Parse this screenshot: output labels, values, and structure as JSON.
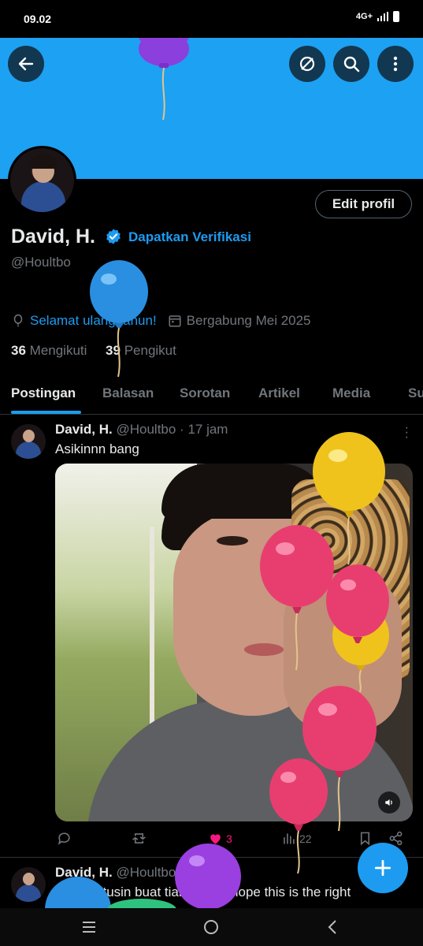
{
  "status_bar": {
    "time": "09.02",
    "network": "4G+"
  },
  "header": {
    "back_icon": "arrow-left-icon",
    "action_icons": [
      "no-grok-icon",
      "search-icon",
      "more-vertical-icon"
    ],
    "banner_color": "#1da1f2"
  },
  "profile": {
    "edit_label": "Edit profil",
    "name": "David, H.",
    "verify_label": "Dapatkan Verifikasi",
    "handle": "@Houltbo",
    "birthday_label": "Selamat ulang tahun!",
    "joined_label": "Bergabung Mei 2025",
    "following_count": "36",
    "following_label": "Mengikuti",
    "followers_count": "39",
    "followers_label": "Pengikut"
  },
  "tabs": [
    {
      "label": "Postingan",
      "active": true
    },
    {
      "label": "Balasan",
      "active": false
    },
    {
      "label": "Sorotan",
      "active": false
    },
    {
      "label": "Artikel",
      "active": false
    },
    {
      "label": "Media",
      "active": false
    },
    {
      "label": "Su",
      "active": false
    }
  ],
  "posts": [
    {
      "name": "David, H.",
      "meta": "@Houltbo · 17 jam",
      "text": "Asikinnn bang",
      "actions": {
        "replies": "",
        "reposts": "",
        "likes": "3",
        "views": "22"
      }
    },
    {
      "name": "David, H.",
      "meta": "@Houltbo · 22 Jun",
      "text": "Gua mutusin buat tiang and I hope this is the right"
    }
  ],
  "colors": {
    "accent": "#1d9bf0",
    "like": "#f91880",
    "background": "#000000"
  }
}
